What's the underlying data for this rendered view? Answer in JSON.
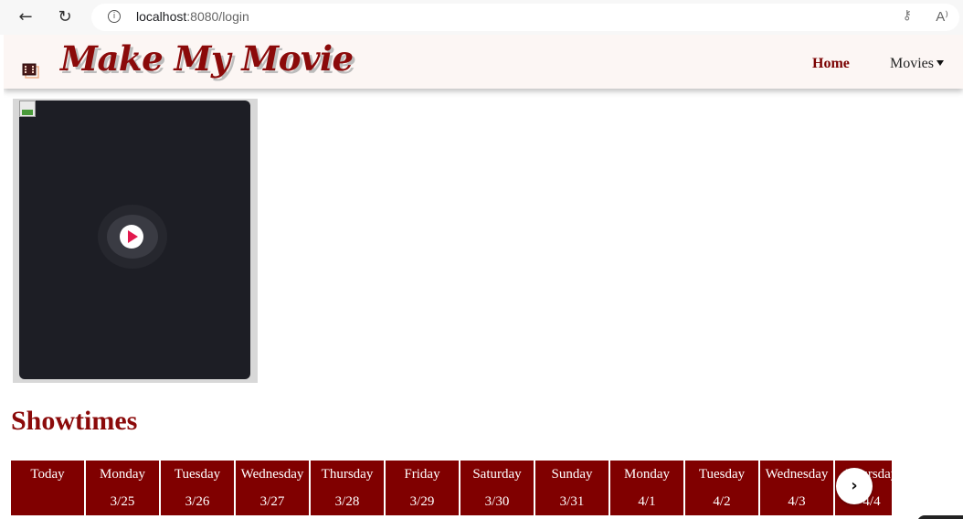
{
  "browser": {
    "back_glyph": "←",
    "reload_glyph": "↻",
    "info_glyph": "i",
    "url_host": "localhost",
    "url_rest": ":8080/login",
    "read_aloud_glyph": "A⁾",
    "key_glyph": "⚷"
  },
  "navbar": {
    "brand": "Make My Movie",
    "home": "Home",
    "movies": "Movies",
    "accent_color": "#800000"
  },
  "trailer": {
    "icon": "play-icon"
  },
  "showtimes": {
    "title": "Showtimes",
    "dates": [
      {
        "day": "Today",
        "date": ""
      },
      {
        "day": "Monday",
        "date": "3/25"
      },
      {
        "day": "Tuesday",
        "date": "3/26"
      },
      {
        "day": "Wednesday",
        "date": "3/27"
      },
      {
        "day": "Thursday",
        "date": "3/28"
      },
      {
        "day": "Friday",
        "date": "3/29"
      },
      {
        "day": "Saturday",
        "date": "3/30"
      },
      {
        "day": "Sunday",
        "date": "3/31"
      },
      {
        "day": "Monday",
        "date": "4/1"
      },
      {
        "day": "Tuesday",
        "date": "4/2"
      },
      {
        "day": "Wednesday",
        "date": "4/3"
      },
      {
        "day": "Thursday",
        "date": "4/4"
      }
    ],
    "next_glyph": "›"
  }
}
